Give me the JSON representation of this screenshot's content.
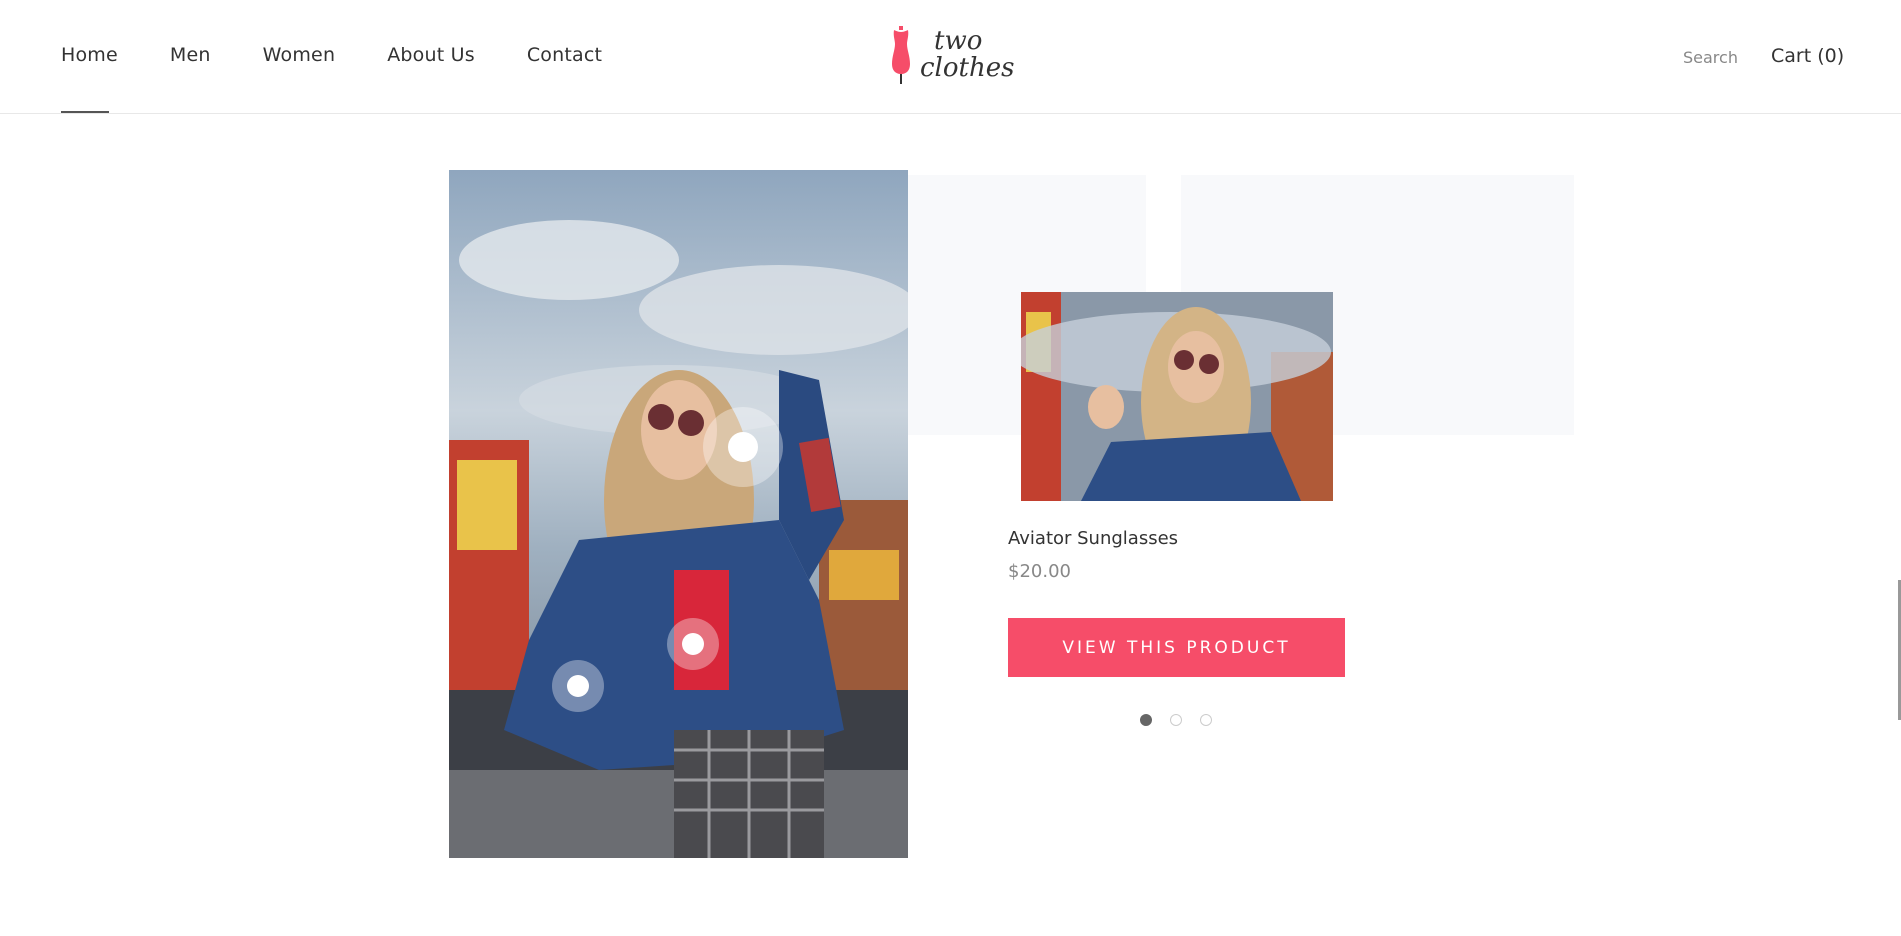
{
  "header": {
    "nav": [
      {
        "label": "Home"
      },
      {
        "label": "Men"
      },
      {
        "label": "Women"
      },
      {
        "label": "About Us"
      },
      {
        "label": "Contact"
      }
    ],
    "logo_line1": "two",
    "logo_line2": "clothes",
    "search_label": "Search",
    "cart_label": "Cart (0)"
  },
  "product": {
    "name": "Aviator Sunglasses",
    "price": "$20.00",
    "cta_label": "VIEW THIS PRODUCT"
  },
  "carousel": {
    "count": 3,
    "active_index": 0
  },
  "colors": {
    "accent": "#f64d69",
    "text": "#333333",
    "muted": "#888888"
  },
  "icons": [
    "dress-form-icon"
  ]
}
